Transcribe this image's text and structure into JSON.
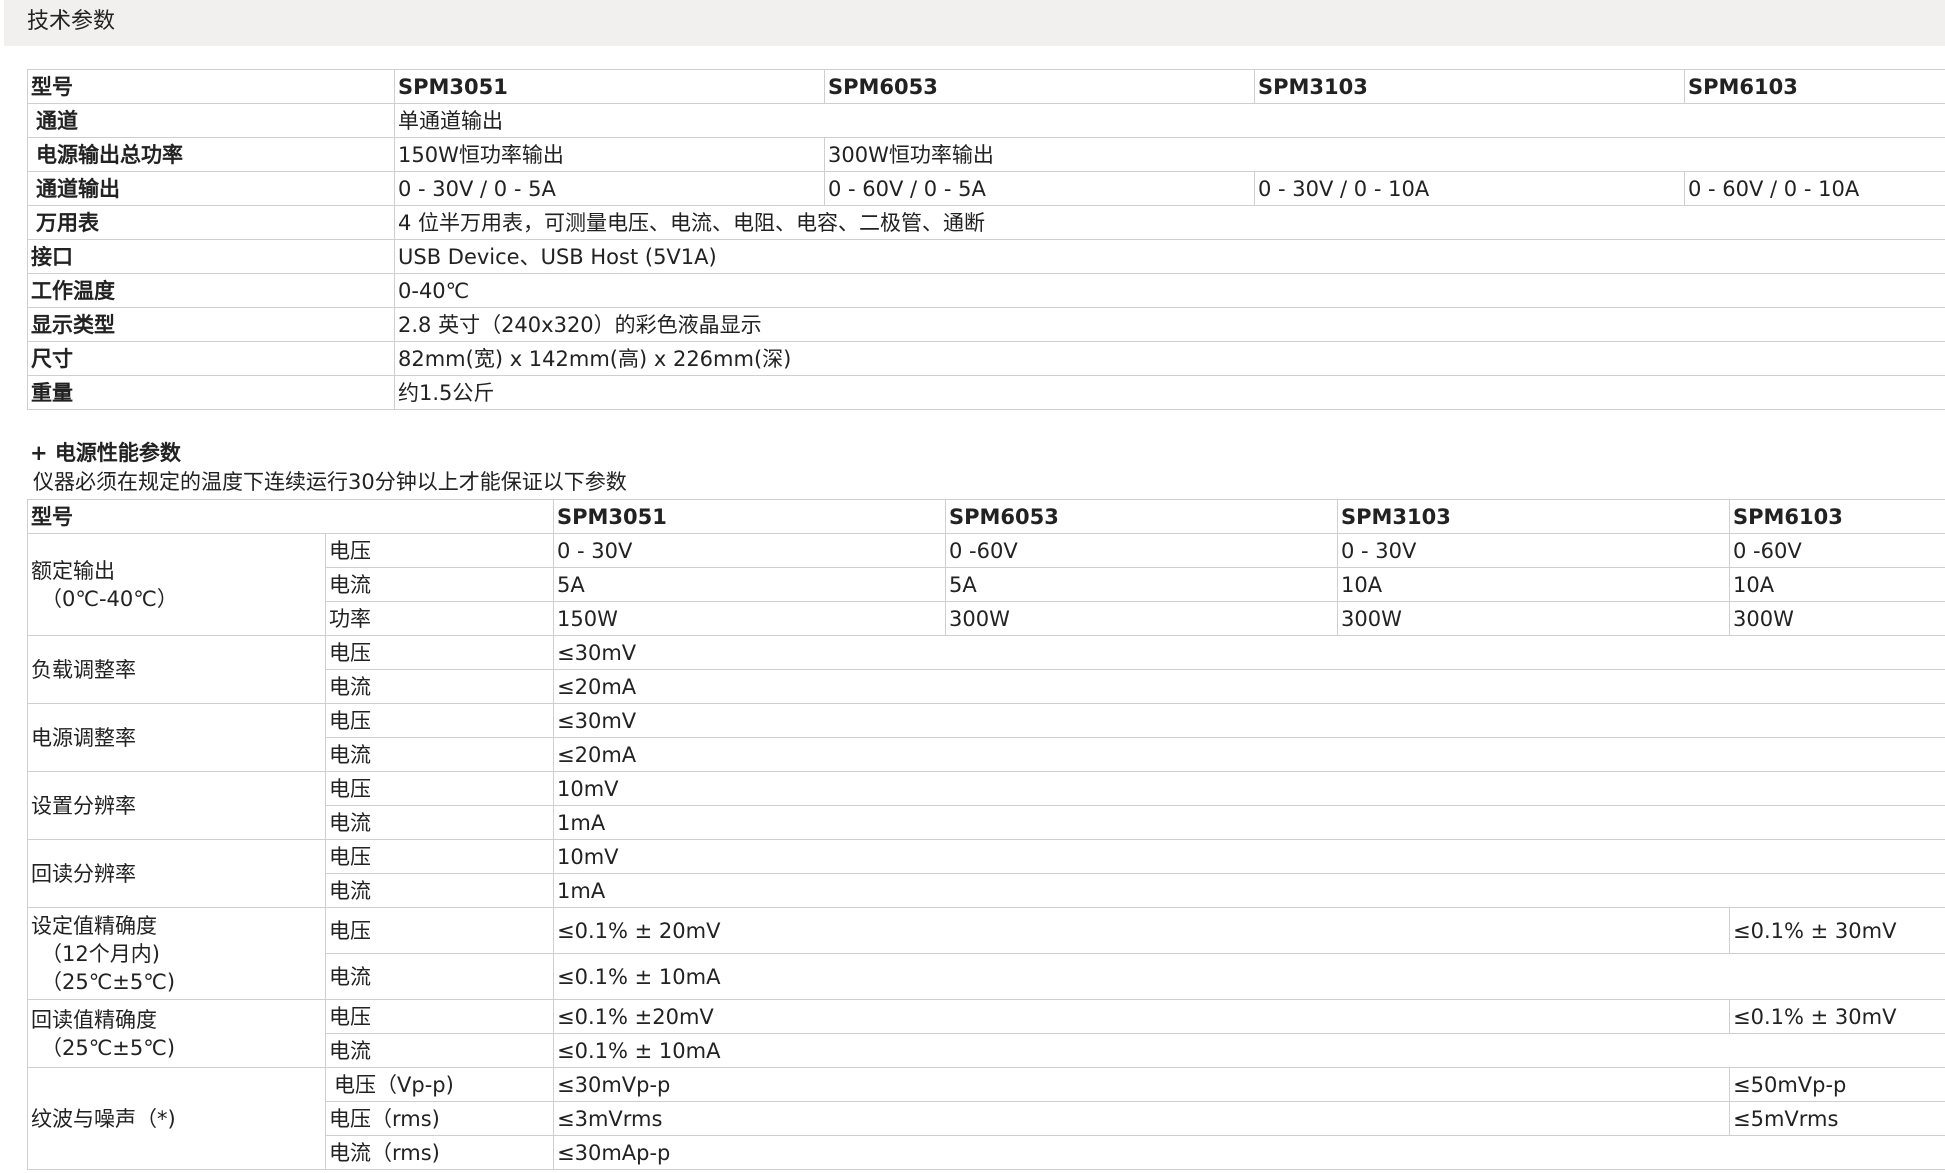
{
  "header": {
    "title": "技术参数"
  },
  "spec": {
    "model_label": "型号",
    "models": [
      "SPM3051",
      "SPM6053",
      "SPM3103",
      "SPM6103"
    ],
    "channel_label": "通道",
    "channel_value": "单通道输出",
    "power_label": "电源输出总功率",
    "power_values": [
      "150W恒功率输出",
      "300W恒功率输出"
    ],
    "output_label": "通道输出",
    "output_values": [
      "0 - 30V / 0 - 5A",
      "0 - 60V / 0 - 5A",
      "0 - 30V / 0 - 10A",
      "0 - 60V / 0 - 10A"
    ],
    "meter_label": "万用表",
    "meter_value": "4 位半万用表，可测量电压、电流、电阻、电容、二极管、通断",
    "interface_label": "接口",
    "interface_value": "USB Device、USB Host (5V1A)",
    "temp_label": "工作温度",
    "temp_value": "0-40℃",
    "display_label": "显示类型",
    "display_value": "2.8 英寸（240x320）的彩色液晶显示",
    "size_label": "尺寸",
    "size_value": "82mm(宽) x 142mm(高) x 226mm(深)",
    "weight_label": "重量",
    "weight_value": "约1.5公斤"
  },
  "perf": {
    "title": "+ 电源性能参数",
    "note": "仪器必须在规定的温度下连续运行30分钟以上才能保证以下参数",
    "model_label": "型号",
    "models": [
      "SPM3051",
      "SPM6053",
      "SPM3103",
      "SPM6103"
    ],
    "rated": {
      "label_line1": "额定输出",
      "label_line2": "（0℃-40℃）",
      "voltage_label": "电压",
      "voltage_values": [
        "0 - 30V",
        "0 -60V",
        "0 - 30V",
        "0 -60V"
      ],
      "current_label": "电流",
      "current_values": [
        "5A",
        "5A",
        "10A",
        "10A"
      ],
      "power_label": "功率",
      "power_values": [
        "150W",
        "300W",
        "300W",
        "300W"
      ]
    },
    "load_reg": {
      "label": "负载调整率",
      "voltage_label": "电压",
      "voltage_value": "≤30mV",
      "current_label": "电流",
      "current_value": "≤20mA"
    },
    "line_reg": {
      "label": "电源调整率",
      "voltage_label": "电压",
      "voltage_value": "≤30mV",
      "current_label": "电流",
      "current_value": "≤20mA"
    },
    "set_res": {
      "label": "设置分辨率",
      "voltage_label": "电压",
      "voltage_value": "10mV",
      "current_label": "电流",
      "current_value": "1mA"
    },
    "read_res": {
      "label": "回读分辨率",
      "voltage_label": "电压",
      "voltage_value": "10mV",
      "current_label": "电流",
      "current_value": "1mA"
    },
    "set_acc": {
      "label_line1": "设定值精确度",
      "label_line2": "（12个月内)",
      "label_line3": "（25℃±5℃)",
      "voltage_label": "电压",
      "voltage_value": "≤0.1% ± 20mV",
      "voltage_value_last": "≤0.1% ± 30mV",
      "current_label": "电流",
      "current_value": "≤0.1% ± 10mA"
    },
    "read_acc": {
      "label_line1": "回读值精确度",
      "label_line2": "（25℃±5℃)",
      "voltage_label": "电压",
      "voltage_value": "≤0.1% ±20mV",
      "voltage_value_last": "≤0.1% ± 30mV",
      "current_label": "电流",
      "current_value": "≤0.1% ± 10mA"
    },
    "ripple": {
      "label": "纹波与噪声（*)",
      "vpp_label": "电压（Vp-p)",
      "vpp_value": "≤30mVp-p",
      "vpp_value_last": "≤50mVp-p",
      "vrms_label": "电压（rms)",
      "vrms_value": "≤3mVrms",
      "vrms_value_last": "≤5mVrms",
      "irms_label": "电流（rms)",
      "irms_value": "≤30mAp-p"
    }
  }
}
